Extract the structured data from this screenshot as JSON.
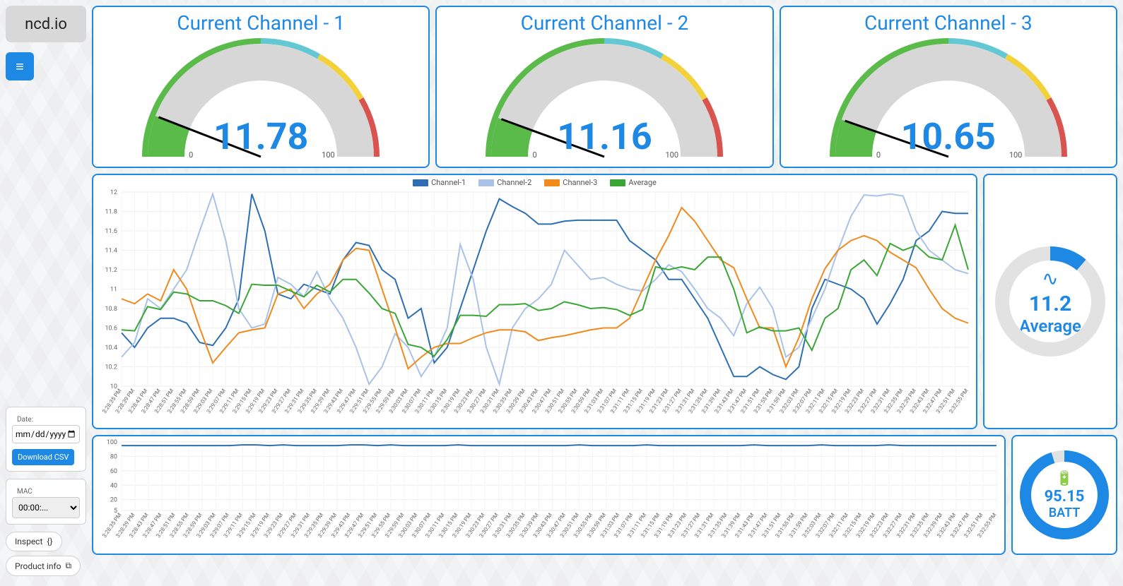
{
  "brand": "ncd.io",
  "sidebar": {
    "date_label": "Date:",
    "date_placeholder": "mm/dd/yyyy",
    "download_label": "Download CSV",
    "mac_label": "MAC",
    "mac_value": "00:00:...",
    "inspect_label": "Inspect",
    "product_info_label": "Product info"
  },
  "gauges": [
    {
      "title": "Current Channel - 1",
      "value": "11.78",
      "min": "0",
      "max": "100",
      "pct": 11.78
    },
    {
      "title": "Current Channel - 2",
      "value": "11.16",
      "min": "0",
      "max": "100",
      "pct": 11.16
    },
    {
      "title": "Current Channel - 3",
      "value": "10.65",
      "min": "0",
      "max": "100",
      "pct": 10.65
    }
  ],
  "average": {
    "value": "11.2",
    "label": "Average"
  },
  "battery": {
    "value": "95.15",
    "label": "BATT"
  },
  "chart_data": {
    "main": {
      "type": "line",
      "title": "",
      "ylabel": "",
      "xlabel": "",
      "ylim": [
        10.0,
        12.0
      ],
      "yticks": [
        10.0,
        10.2,
        10.4,
        10.6,
        10.8,
        11.0,
        11.2,
        11.4,
        11.6,
        11.8,
        12.0
      ],
      "categories": [
        "3:28:35 PM",
        "3:28:39 PM",
        "3:28:43 PM",
        "3:28:47 PM",
        "3:28:51 PM",
        "3:28:55 PM",
        "3:28:59 PM",
        "3:29:03 PM",
        "3:29:07 PM",
        "3:29:11 PM",
        "3:29:15 PM",
        "3:29:19 PM",
        "3:29:23 PM",
        "3:29:27 PM",
        "3:29:31 PM",
        "3:29:35 PM",
        "3:29:39 PM",
        "3:29:43 PM",
        "3:29:47 PM",
        "3:29:51 PM",
        "3:29:55 PM",
        "3:29:59 PM",
        "3:30:03 PM",
        "3:30:07 PM",
        "3:30:11 PM",
        "3:30:15 PM",
        "3:30:19 PM",
        "3:30:23 PM",
        "3:30:27 PM",
        "3:30:31 PM",
        "3:30:35 PM",
        "3:30:39 PM",
        "3:30:43 PM",
        "3:30:47 PM",
        "3:30:51 PM",
        "3:30:55 PM",
        "3:30:59 PM",
        "3:31:03 PM",
        "3:31:07 PM",
        "3:31:11 PM",
        "3:31:15 PM",
        "3:31:19 PM",
        "3:31:23 PM",
        "3:31:27 PM",
        "3:31:31 PM",
        "3:31:35 PM",
        "3:31:39 PM",
        "3:31:43 PM",
        "3:31:47 PM",
        "3:31:51 PM",
        "3:31:55 PM",
        "3:31:59 PM",
        "3:32:03 PM",
        "3:32:07 PM",
        "3:32:11 PM",
        "3:32:15 PM",
        "3:32:19 PM",
        "3:32:23 PM",
        "3:32:27 PM",
        "3:32:31 PM",
        "3:32:35 PM",
        "3:32:39 PM",
        "3:32:43 PM",
        "3:32:47 PM",
        "3:32:51 PM",
        "3:32:55 PM"
      ],
      "legend": [
        "Channel-1",
        "Channel-2",
        "Channel-3",
        "Average"
      ],
      "colors": {
        "Channel-1": "#2e6fb4",
        "Channel-2": "#a9c3e8",
        "Channel-3": "#f08a1d",
        "Average": "#3aa636"
      },
      "series": [
        {
          "name": "Channel-1",
          "values": [
            10.55,
            10.4,
            10.6,
            10.7,
            10.7,
            10.65,
            10.45,
            10.42,
            10.6,
            10.9,
            11.98,
            11.6,
            10.95,
            10.9,
            11.05,
            11.0,
            10.95,
            11.3,
            11.48,
            11.45,
            11.2,
            11.1,
            10.7,
            10.8,
            10.24,
            10.4,
            10.8,
            11.2,
            11.6,
            11.93,
            11.85,
            11.78,
            11.67,
            11.67,
            11.7,
            11.71,
            11.71,
            11.71,
            11.71,
            11.5,
            11.4,
            11.3,
            11.1,
            11.1,
            10.9,
            10.7,
            10.4,
            10.1,
            10.1,
            10.2,
            10.12,
            10.07,
            10.2,
            10.8,
            11.1,
            11.05,
            11.0,
            10.9,
            10.64,
            10.85,
            11.1,
            11.5,
            11.6,
            11.8,
            11.78,
            11.78
          ]
        },
        {
          "name": "Channel-2",
          "values": [
            10.3,
            10.45,
            10.9,
            10.8,
            11.0,
            11.2,
            11.6,
            11.98,
            11.5,
            10.8,
            10.6,
            10.64,
            11.12,
            11.05,
            10.92,
            11.18,
            10.9,
            10.7,
            10.4,
            10.02,
            10.2,
            10.54,
            10.4,
            10.1,
            10.3,
            10.6,
            11.46,
            11.1,
            10.4,
            10.02,
            10.6,
            10.8,
            10.9,
            11.05,
            11.4,
            11.25,
            11.1,
            11.12,
            11.05,
            11.0,
            10.98,
            11.1,
            11.25,
            11.18,
            11.0,
            10.8,
            10.7,
            10.52,
            10.85,
            11.02,
            10.8,
            10.3,
            10.4,
            10.7,
            11.0,
            11.4,
            11.75,
            11.97,
            11.96,
            11.98,
            11.96,
            11.6,
            11.4,
            11.3,
            11.2,
            11.16
          ]
        },
        {
          "name": "Channel-3",
          "values": [
            10.9,
            10.85,
            10.95,
            10.88,
            11.2,
            11.0,
            10.6,
            10.24,
            10.4,
            10.55,
            10.58,
            10.6,
            10.95,
            11.0,
            10.8,
            10.95,
            11.05,
            11.3,
            11.42,
            11.4,
            11.0,
            10.6,
            10.18,
            10.3,
            10.4,
            10.44,
            10.44,
            10.5,
            10.55,
            10.58,
            10.58,
            10.56,
            10.47,
            10.5,
            10.52,
            10.55,
            10.58,
            10.6,
            10.6,
            10.7,
            11.0,
            11.3,
            11.55,
            11.84,
            11.7,
            11.5,
            11.3,
            11.22,
            10.9,
            10.6,
            10.6,
            10.2,
            10.5,
            10.9,
            11.21,
            11.4,
            11.5,
            11.55,
            11.5,
            11.38,
            11.3,
            11.22,
            11.0,
            10.8,
            10.7,
            10.65
          ]
        },
        {
          "name": "Average",
          "values": [
            10.58,
            10.57,
            10.82,
            10.79,
            10.97,
            10.95,
            10.88,
            10.88,
            10.83,
            10.75,
            11.05,
            11.04,
            11.04,
            10.98,
            10.92,
            11.04,
            10.97,
            11.1,
            11.1,
            10.96,
            10.8,
            10.75,
            10.43,
            10.4,
            10.31,
            10.48,
            10.73,
            10.73,
            10.72,
            10.84,
            10.84,
            10.85,
            10.78,
            10.8,
            10.87,
            10.84,
            10.8,
            10.81,
            10.79,
            10.73,
            10.79,
            11.23,
            11.2,
            11.23,
            11.2,
            11.33,
            11.33,
            11.0,
            10.55,
            10.61,
            10.57,
            10.57,
            10.6,
            10.37,
            10.7,
            10.8,
            11.2,
            11.3,
            11.14,
            11.47,
            11.4,
            11.45,
            11.33,
            11.3,
            11.66,
            11.2
          ]
        }
      ]
    },
    "battery": {
      "type": "line",
      "ylim": [
        5,
        100
      ],
      "yticks": [
        5,
        20,
        40,
        60,
        80,
        100
      ],
      "categories_ref": "main",
      "series": [
        {
          "name": "BATT",
          "color": "#2e6fb4",
          "values": [
            95,
            95,
            95,
            95,
            95,
            95,
            95,
            95,
            95,
            96,
            96,
            95,
            96,
            95,
            95,
            95,
            95,
            96,
            96,
            95,
            96,
            95,
            95,
            95,
            95,
            96,
            95,
            95,
            95,
            95,
            95,
            95,
            95,
            95,
            96,
            95,
            95,
            95,
            95,
            96,
            95,
            95,
            95,
            95,
            95,
            95,
            95,
            96,
            95,
            95,
            95,
            95,
            96,
            95,
            95,
            95,
            95,
            96,
            95,
            95,
            95,
            95,
            95,
            95,
            95,
            95
          ]
        }
      ]
    }
  }
}
